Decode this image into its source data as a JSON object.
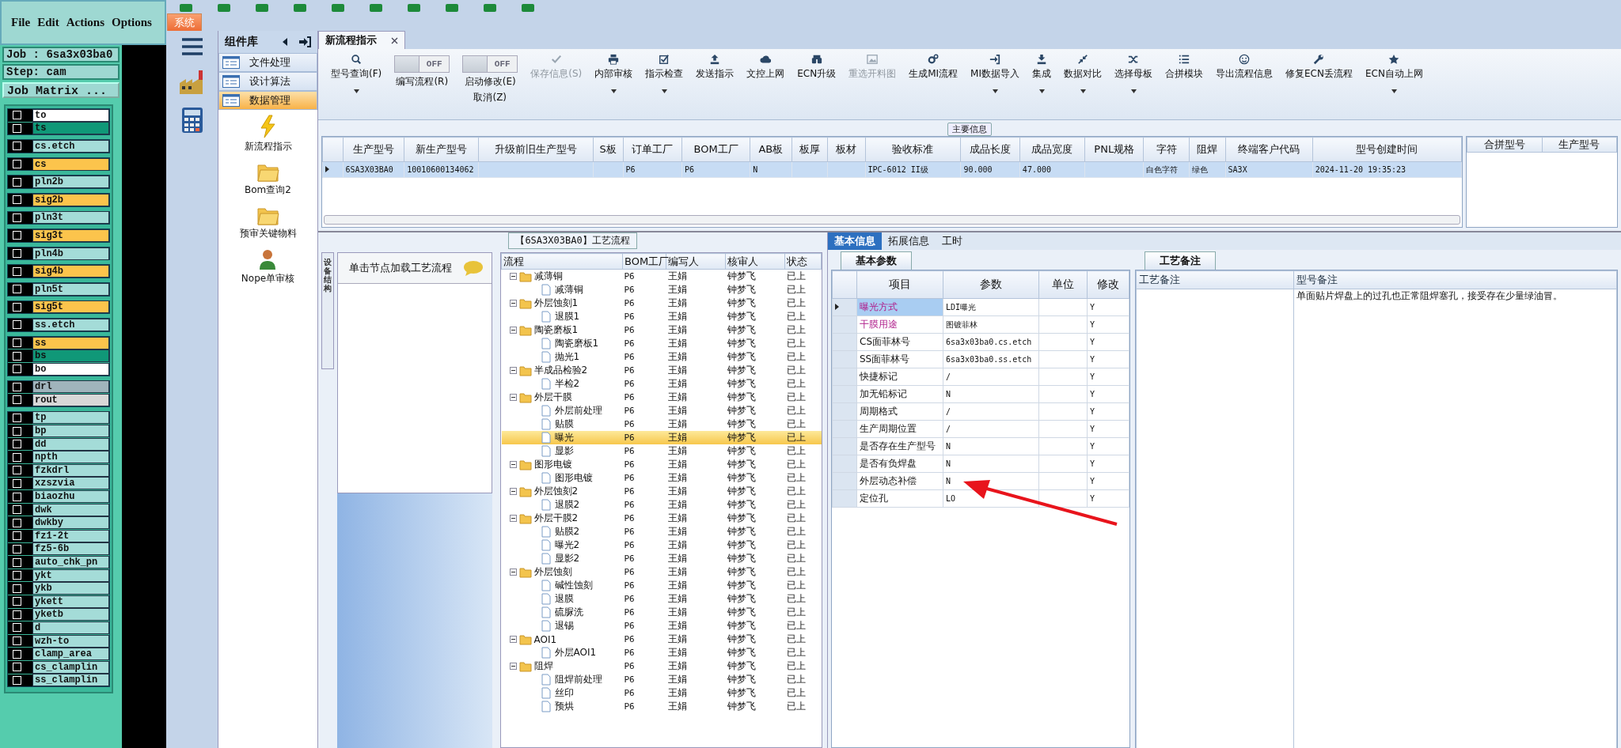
{
  "xpanel": {
    "menu": [
      "File",
      "Edit",
      "Actions",
      "Options"
    ],
    "job": "Job : 6sa3x03ba0",
    "step": "Step: cam",
    "matrix_button": "Job Matrix ...",
    "layer_groups": [
      {
        "layers": [
          {
            "name": "to",
            "color": "#ffffff",
            "checked": false
          },
          {
            "name": "ts",
            "color": "#109878",
            "checked": false
          }
        ]
      },
      {
        "layers": [
          {
            "name": "cs.etch",
            "color": "#a4dcd8",
            "checked": false
          }
        ]
      },
      {
        "layers": [
          {
            "name": "cs",
            "color": "#fcc44c",
            "checked": false
          }
        ]
      },
      {
        "layers": [
          {
            "name": "pln2b",
            "color": "#a4dcd8",
            "checked": false
          }
        ]
      },
      {
        "layers": [
          {
            "name": "sig2b",
            "color": "#fcc44c",
            "checked": false
          }
        ]
      },
      {
        "layers": [
          {
            "name": "pln3t",
            "color": "#a4dcd8",
            "checked": false
          }
        ]
      },
      {
        "layers": [
          {
            "name": "sig3t",
            "color": "#fcc44c",
            "checked": false
          }
        ]
      },
      {
        "layers": [
          {
            "name": "pln4b",
            "color": "#a4dcd8",
            "checked": false
          }
        ]
      },
      {
        "layers": [
          {
            "name": "sig4b",
            "color": "#fcc44c",
            "checked": false
          }
        ]
      },
      {
        "layers": [
          {
            "name": "pln5t",
            "color": "#a4dcd8",
            "checked": false
          }
        ]
      },
      {
        "layers": [
          {
            "name": "sig5t",
            "color": "#fcc44c",
            "checked": false
          }
        ]
      },
      {
        "layers": [
          {
            "name": "ss.etch",
            "color": "#a4dcd8",
            "checked": false
          }
        ]
      },
      {
        "layers": [
          {
            "name": "ss",
            "color": "#fcc44c",
            "checked": false
          },
          {
            "name": "bs",
            "color": "#109878",
            "checked": false
          },
          {
            "name": "bo",
            "color": "#ffffff",
            "checked": false
          }
        ]
      },
      {
        "layers": [
          {
            "name": "drl",
            "color": "#a0b4bc",
            "checked": false
          },
          {
            "name": "rout",
            "color": "#d8d8d8",
            "checked": false
          }
        ]
      },
      {
        "layers": [
          {
            "name": "tp",
            "color": "#a4dcd8",
            "checked": false
          },
          {
            "name": "bp",
            "color": "#a4dcd8",
            "checked": false
          },
          {
            "name": "dd",
            "color": "#a4dcd8",
            "checked": false
          },
          {
            "name": "npth",
            "color": "#a4dcd8",
            "checked": false
          },
          {
            "name": "fzkdrl",
            "color": "#a4dcd8",
            "checked": false
          },
          {
            "name": "xzszvia",
            "color": "#a4dcd8",
            "checked": false
          },
          {
            "name": "biaozhu",
            "color": "#a4dcd8",
            "checked": false
          },
          {
            "name": "dwk",
            "color": "#a4dcd8",
            "checked": false
          },
          {
            "name": "dwkby",
            "color": "#a4dcd8",
            "checked": false
          },
          {
            "name": "fz1-2t",
            "color": "#a4dcd8",
            "checked": false
          },
          {
            "name": "fz5-6b",
            "color": "#a4dcd8",
            "checked": false
          },
          {
            "name": "auto_chk_pn",
            "color": "#a4dcd8",
            "checked": false
          },
          {
            "name": "ykt",
            "color": "#a4dcd8",
            "checked": false
          },
          {
            "name": "ykb",
            "color": "#a4dcd8",
            "checked": false
          },
          {
            "name": "ykett",
            "color": "#a4dcd8",
            "checked": false
          },
          {
            "name": "yketb",
            "color": "#a4dcd8",
            "checked": false
          },
          {
            "name": "d",
            "color": "#a4dcd8",
            "checked": false
          },
          {
            "name": "wzh-to",
            "color": "#a4dcd8",
            "checked": false
          },
          {
            "name": "clamp_area",
            "color": "#a4dcd8",
            "checked": false
          },
          {
            "name": "cs_clamplin",
            "color": "#a4dcd8",
            "checked": false
          },
          {
            "name": "ss_clamplin",
            "color": "#a4dcd8",
            "checked": false
          }
        ]
      }
    ]
  },
  "system_tab": "系统",
  "component_library": {
    "title": "组件库",
    "items": [
      {
        "label": "文件处理",
        "selected": false
      },
      {
        "label": "设计算法",
        "selected": false
      },
      {
        "label": "数据管理",
        "selected": true
      }
    ],
    "tools": [
      {
        "label": "新流程指示"
      },
      {
        "label": "Bom查询2"
      },
      {
        "label": "预审关键物料"
      },
      {
        "label": "Nope单审核"
      }
    ]
  },
  "document_tab": {
    "title": "新流程指示"
  },
  "toolbar": [
    {
      "kind": "button",
      "label": "型号查询(F)",
      "disabled": false,
      "dropdown": true
    },
    {
      "kind": "toggle",
      "label": "编写流程(R)",
      "state_label": "OFF",
      "on": false,
      "disabled": false,
      "dropdown": false
    },
    {
      "kind": "toggle",
      "label": "启动修改(E)",
      "second_line": "取消(Z)",
      "state_label": "OFF",
      "on": false,
      "disabled": false,
      "dropdown": false
    },
    {
      "kind": "button",
      "label": "保存信息(S)",
      "disabled": true,
      "dropdown": false
    },
    {
      "kind": "button",
      "label": "内部审核",
      "disabled": false,
      "dropdown": true
    },
    {
      "kind": "button",
      "label": "指示检查",
      "disabled": false,
      "dropdown": true
    },
    {
      "kind": "button",
      "label": "发送指示",
      "disabled": false,
      "dropdown": false
    },
    {
      "kind": "button",
      "label": "文控上网",
      "disabled": false,
      "dropdown": false
    },
    {
      "kind": "button",
      "label": "ECN升级",
      "disabled": false,
      "dropdown": false
    },
    {
      "kind": "button",
      "label": "重选开料图",
      "disabled": true,
      "dropdown": false
    },
    {
      "kind": "button",
      "label": "生成MI流程",
      "disabled": false,
      "dropdown": false
    },
    {
      "kind": "button",
      "label": "MI数据导入",
      "disabled": false,
      "dropdown": true
    },
    {
      "kind": "button",
      "label": "集成",
      "disabled": false,
      "dropdown": true
    },
    {
      "kind": "button",
      "label": "数据对比",
      "disabled": false,
      "dropdown": true
    },
    {
      "kind": "button",
      "label": "选择母板",
      "disabled": false,
      "dropdown": true
    },
    {
      "kind": "button",
      "label": "合拼模块",
      "disabled": false,
      "dropdown": false
    },
    {
      "kind": "button",
      "label": "导出流程信息",
      "disabled": false,
      "dropdown": false
    },
    {
      "kind": "button",
      "label": "修复ECN丢流程",
      "disabled": false,
      "dropdown": false
    },
    {
      "kind": "button",
      "label": "ECN自动上网",
      "disabled": false,
      "dropdown": true
    }
  ],
  "main_info": {
    "title": "主要信息",
    "columns": [
      "生产型号",
      "新生产型号",
      "升级前旧生产型号",
      "S板",
      "订单工厂",
      "BOM工厂",
      "AB板",
      "板厚",
      "板材",
      "验收标准",
      "成品长度",
      "成品宽度",
      "PNL规格",
      "字符",
      "阻焊",
      "终端客户代码",
      "型号创建时间"
    ],
    "rows": [
      {
        "selected": true,
        "cells": [
          "6SA3X03BA0",
          "10010600134062",
          "",
          "",
          "P6",
          "P6",
          "N",
          "",
          "",
          "IPC-6012 II级",
          "90.000",
          "47.000",
          "",
          "白色字符",
          "绿色",
          "SA3X",
          "2024-11-20 19:35:23"
        ]
      }
    ],
    "side_columns": [
      "合拼型号",
      "生产型号"
    ]
  },
  "process_panel": {
    "title": "【6SA3X03BA0】工艺流程",
    "side_tab": "设备结构",
    "hint": "单击节点加载工艺流程",
    "columns": [
      "流程",
      "BOM工厂",
      "编写人",
      "核审人",
      "状态"
    ],
    "tree": [
      {
        "label": "减薄铜",
        "kind": "folder",
        "expanded": true,
        "selected": false,
        "bom": "P6",
        "writer": "王娟",
        "reviewer": "钟梦飞",
        "status": "已上",
        "children": [
          {
            "label": "减薄铜",
            "kind": "file",
            "selected": false,
            "bom": "P6",
            "writer": "王娟",
            "reviewer": "钟梦飞",
            "status": "已上"
          }
        ]
      },
      {
        "label": "外层蚀刻1",
        "kind": "folder",
        "expanded": true,
        "selected": false,
        "bom": "P6",
        "writer": "王娟",
        "reviewer": "钟梦飞",
        "status": "已上",
        "children": [
          {
            "label": "退膜1",
            "kind": "file",
            "selected": false,
            "bom": "P6",
            "writer": "王娟",
            "reviewer": "钟梦飞",
            "status": "已上"
          }
        ]
      },
      {
        "label": "陶瓷磨板1",
        "kind": "folder",
        "expanded": true,
        "selected": false,
        "bom": "P6",
        "writer": "王娟",
        "reviewer": "钟梦飞",
        "status": "已上",
        "children": [
          {
            "label": "陶瓷磨板1",
            "kind": "file",
            "selected": false,
            "bom": "P6",
            "writer": "王娟",
            "reviewer": "钟梦飞",
            "status": "已上"
          },
          {
            "label": "抛光1",
            "kind": "file",
            "selected": false,
            "bom": "P6",
            "writer": "王娟",
            "reviewer": "钟梦飞",
            "status": "已上"
          }
        ]
      },
      {
        "label": "半成品检验2",
        "kind": "folder",
        "expanded": true,
        "selected": false,
        "bom": "P6",
        "writer": "王娟",
        "reviewer": "钟梦飞",
        "status": "已上",
        "children": [
          {
            "label": "半检2",
            "kind": "file",
            "selected": false,
            "bom": "P6",
            "writer": "王娟",
            "reviewer": "钟梦飞",
            "status": "已上"
          }
        ]
      },
      {
        "label": "外层干膜",
        "kind": "folder",
        "expanded": true,
        "selected": false,
        "bom": "P6",
        "writer": "王娟",
        "reviewer": "钟梦飞",
        "status": "已上",
        "children": [
          {
            "label": "外层前处理",
            "kind": "file",
            "selected": false,
            "bom": "P6",
            "writer": "王娟",
            "reviewer": "钟梦飞",
            "status": "已上"
          },
          {
            "label": "贴膜",
            "kind": "file",
            "selected": false,
            "bom": "P6",
            "writer": "王娟",
            "reviewer": "钟梦飞",
            "status": "已上"
          },
          {
            "label": "曝光",
            "kind": "file",
            "selected": true,
            "bom": "P6",
            "writer": "王娟",
            "reviewer": "钟梦飞",
            "status": "已上"
          },
          {
            "label": "显影",
            "kind": "file",
            "selected": false,
            "bom": "P6",
            "writer": "王娟",
            "reviewer": "钟梦飞",
            "status": "已上"
          }
        ]
      },
      {
        "label": "图形电镀",
        "kind": "folder",
        "expanded": true,
        "selected": false,
        "bom": "P6",
        "writer": "王娟",
        "reviewer": "钟梦飞",
        "status": "已上",
        "children": [
          {
            "label": "图形电镀",
            "kind": "file",
            "selected": false,
            "bom": "P6",
            "writer": "王娟",
            "reviewer": "钟梦飞",
            "status": "已上"
          }
        ]
      },
      {
        "label": "外层蚀刻2",
        "kind": "folder",
        "expanded": true,
        "selected": false,
        "bom": "P6",
        "writer": "王娟",
        "reviewer": "钟梦飞",
        "status": "已上",
        "children": [
          {
            "label": "退膜2",
            "kind": "file",
            "selected": false,
            "bom": "P6",
            "writer": "王娟",
            "reviewer": "钟梦飞",
            "status": "已上"
          }
        ]
      },
      {
        "label": "外层干膜2",
        "kind": "folder",
        "expanded": true,
        "selected": false,
        "bom": "P6",
        "writer": "王娟",
        "reviewer": "钟梦飞",
        "status": "已上",
        "children": [
          {
            "label": "贴膜2",
            "kind": "file",
            "selected": false,
            "bom": "P6",
            "writer": "王娟",
            "reviewer": "钟梦飞",
            "status": "已上"
          },
          {
            "label": "曝光2",
            "kind": "file",
            "selected": false,
            "bom": "P6",
            "writer": "王娟",
            "reviewer": "钟梦飞",
            "status": "已上"
          },
          {
            "label": "显影2",
            "kind": "file",
            "selected": false,
            "bom": "P6",
            "writer": "王娟",
            "reviewer": "钟梦飞",
            "status": "已上"
          }
        ]
      },
      {
        "label": "外层蚀刻",
        "kind": "folder",
        "expanded": true,
        "selected": false,
        "bom": "P6",
        "writer": "王娟",
        "reviewer": "钟梦飞",
        "status": "已上",
        "children": [
          {
            "label": "碱性蚀刻",
            "kind": "file",
            "selected": false,
            "bom": "P6",
            "writer": "王娟",
            "reviewer": "钟梦飞",
            "status": "已上"
          },
          {
            "label": "退膜",
            "kind": "file",
            "selected": false,
            "bom": "P6",
            "writer": "王娟",
            "reviewer": "钟梦飞",
            "status": "已上"
          },
          {
            "label": "硫脲洗",
            "kind": "file",
            "selected": false,
            "bom": "P6",
            "writer": "王娟",
            "reviewer": "钟梦飞",
            "status": "已上"
          },
          {
            "label": "退锡",
            "kind": "file",
            "selected": false,
            "bom": "P6",
            "writer": "王娟",
            "reviewer": "钟梦飞",
            "status": "已上"
          }
        ]
      },
      {
        "label": "AOI1",
        "kind": "folder",
        "expanded": true,
        "selected": false,
        "bom": "P6",
        "writer": "王娟",
        "reviewer": "钟梦飞",
        "status": "已上",
        "children": [
          {
            "label": "外层AOI1",
            "kind": "file",
            "selected": false,
            "bom": "P6",
            "writer": "王娟",
            "reviewer": "钟梦飞",
            "status": "已上"
          }
        ]
      },
      {
        "label": "阻焊",
        "kind": "folder",
        "expanded": true,
        "selected": false,
        "bom": "P6",
        "writer": "王娟",
        "reviewer": "钟梦飞",
        "status": "已上",
        "children": [
          {
            "label": "阻焊前处理",
            "kind": "file",
            "selected": false,
            "bom": "P6",
            "writer": "王娟",
            "reviewer": "钟梦飞",
            "status": "已上"
          },
          {
            "label": "丝印",
            "kind": "file",
            "selected": false,
            "bom": "P6",
            "writer": "王娟",
            "reviewer": "钟梦飞",
            "status": "已上"
          },
          {
            "label": "预烘",
            "kind": "file",
            "selected": false,
            "bom": "P6",
            "writer": "王娟",
            "reviewer": "钟梦飞",
            "status": "已上"
          }
        ]
      }
    ]
  },
  "detail_tabs": [
    {
      "label": "基本信息",
      "selected": true
    },
    {
      "label": "拓展信息",
      "selected": false
    },
    {
      "label": "工时",
      "selected": false
    }
  ],
  "params": {
    "tab": "基本参数",
    "columns": [
      "项目",
      "参数",
      "单位",
      "修改"
    ],
    "rows": [
      {
        "item": "曝光方式",
        "value": "LDI曝光",
        "modify": "Y",
        "highlighted": true,
        "selected": true
      },
      {
        "item": "干膜用途",
        "value": "图镀菲林",
        "modify": "Y",
        "highlighted": true,
        "selected": false
      },
      {
        "item": "CS面菲林号",
        "value": "6sa3x03ba0.cs.etch",
        "modify": "Y",
        "highlighted": false,
        "selected": false
      },
      {
        "item": "SS面菲林号",
        "value": "6sa3x03ba0.ss.etch",
        "modify": "Y",
        "highlighted": false,
        "selected": false
      },
      {
        "item": "快捷标记",
        "value": "/",
        "modify": "Y",
        "highlighted": false,
        "selected": false
      },
      {
        "item": "加无铅标记",
        "value": "N",
        "modify": "Y",
        "highlighted": false,
        "selected": false
      },
      {
        "item": "周期格式",
        "value": "/",
        "modify": "Y",
        "highlighted": false,
        "selected": false
      },
      {
        "item": "生产周期位置",
        "value": "/",
        "modify": "Y",
        "highlighted": false,
        "selected": false
      },
      {
        "item": "是否存在生产型号",
        "value": "N",
        "modify": "Y",
        "highlighted": false,
        "selected": false
      },
      {
        "item": "是否有负焊盘",
        "value": "N",
        "modify": "Y",
        "highlighted": false,
        "selected": false
      },
      {
        "item": "外层动态补偿",
        "value": "N",
        "modify": "Y",
        "highlighted": false,
        "selected": false
      },
      {
        "item": "定位孔",
        "value": "LO",
        "modify": "Y",
        "highlighted": false,
        "selected": false
      }
    ]
  },
  "notes": {
    "tab": "工艺备注",
    "columns": [
      "工艺备注",
      "型号备注"
    ],
    "model_note": "单面贴片焊盘上的过孔也正常阻焊塞孔，接受存在少量绿油冒。"
  }
}
